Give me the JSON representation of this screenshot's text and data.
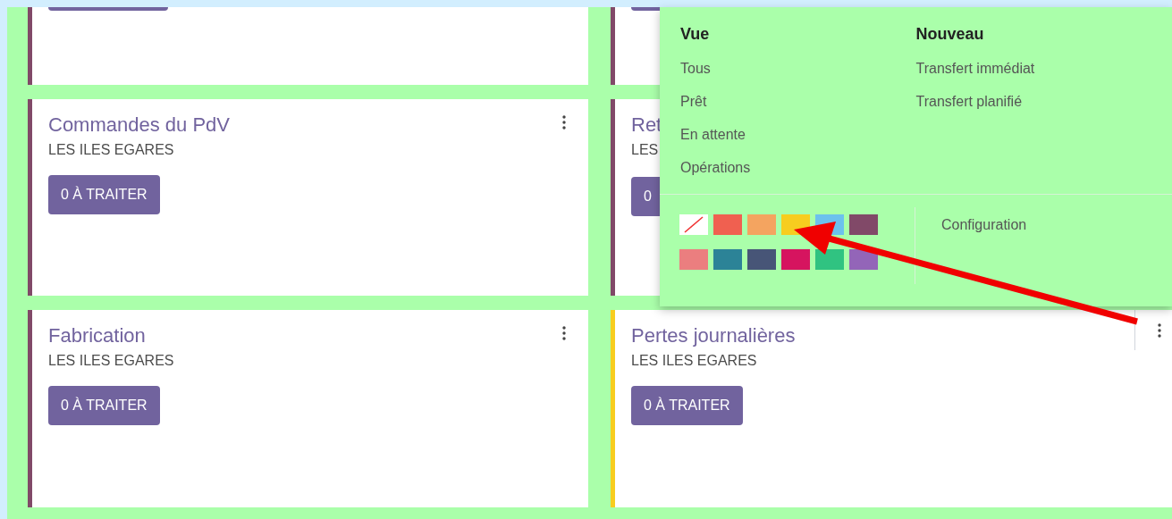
{
  "cards": [
    {
      "kind": "partial",
      "color": "#814968"
    },
    {
      "kind": "partial",
      "color": "#814968"
    },
    {
      "kind": "full",
      "title": "Commandes du PdV",
      "subtitle": "LES ILES EGARES",
      "button": "0 À TRAITER",
      "color": "#814968",
      "menu_open": false
    },
    {
      "kind": "covered",
      "title": "Ret",
      "subtitle": "LES",
      "button": "0",
      "color": "#814968"
    },
    {
      "kind": "full",
      "title": "Fabrication",
      "subtitle": "LES ILES EGARES",
      "button": "0 À TRAITER",
      "color": "#814968",
      "menu_open": false
    },
    {
      "kind": "full",
      "title": "Pertes journalières",
      "subtitle": "LES ILES EGARES",
      "button": "0 À TRAITER",
      "color": "#f7cd1f",
      "menu_open": true
    }
  ],
  "dropdown": {
    "columns": [
      {
        "heading": "Vue",
        "items": [
          "Tous",
          "Prêt",
          "En attente",
          "Opérations"
        ]
      },
      {
        "heading": "Nouveau",
        "items": [
          "Transfert immédiat",
          "Transfert planifié"
        ]
      }
    ],
    "swatches": [
      {
        "kind": "none",
        "color": "#ffffff"
      },
      {
        "kind": "color",
        "color": "#f06050"
      },
      {
        "kind": "color",
        "color": "#f4a460"
      },
      {
        "kind": "color",
        "color": "#f7cd1f"
      },
      {
        "kind": "color",
        "color": "#6cc1ed"
      },
      {
        "kind": "color",
        "color": "#814968"
      },
      {
        "kind": "color",
        "color": "#eb7e7f"
      },
      {
        "kind": "color",
        "color": "#2c8397"
      },
      {
        "kind": "color",
        "color": "#475577"
      },
      {
        "kind": "color",
        "color": "#d6145f"
      },
      {
        "kind": "color",
        "color": "#30c381"
      },
      {
        "kind": "color",
        "color": "#9365b8"
      }
    ],
    "link": "Configuration"
  }
}
